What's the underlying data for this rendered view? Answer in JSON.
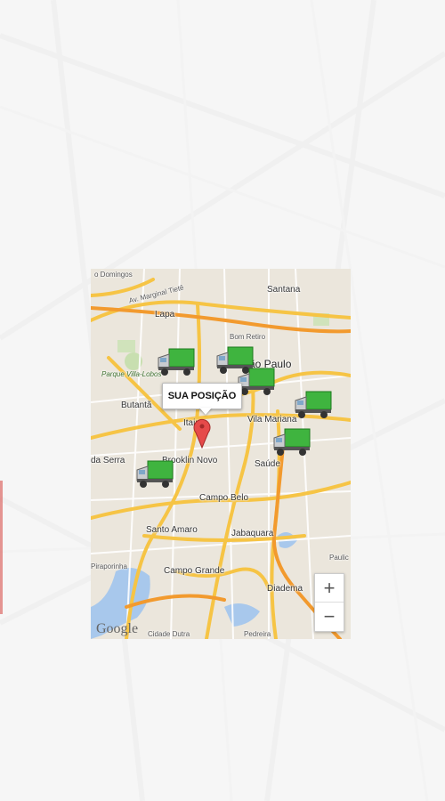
{
  "background": {
    "accent_bar_color": "#d9534f"
  },
  "map": {
    "callout_label": "SUA POSIÇÃO",
    "attribution": "Google",
    "zoom_in_label": "+",
    "zoom_out_label": "−",
    "marker_icon": "truck-icon",
    "pin_icon": "map-pin-icon",
    "places": {
      "sao_domingos": "o Domingos",
      "marginal_tiete": "Av. Marginal Tietê",
      "santana": "Santana",
      "lapa": "Lapa",
      "bom_retiro": "Bom Retiro",
      "sao_paulo": "São Paulo",
      "parque_villa_lobos": "Parque Villa-Lobos",
      "butanta": "Butantã",
      "vila_mariana": "Vila Mariana",
      "itaim": "Itaim",
      "saude": "Saúde",
      "da_serra": "da Serra",
      "brooklin_novo": "Brooklin Novo",
      "campo_belo": "Campo Belo",
      "santo_amaro": "Santo Amaro",
      "jabaquara": "Jabaquara",
      "piraporinha": "Piraporinha",
      "campo_grande": "Campo Grande",
      "paulic": "Paulic",
      "diadema": "Diadema",
      "cidade_dutra": "Cidade Dutra",
      "pedreira": "Pedreira"
    }
  }
}
